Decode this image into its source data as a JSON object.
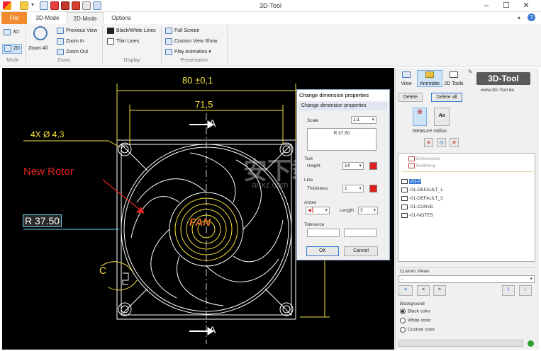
{
  "app": {
    "title": "3D-Tool"
  },
  "window_controls": {
    "minimize": "–",
    "maximize": "☐",
    "close": "✕"
  },
  "tabs": [
    "File",
    "3D-Mode",
    "2D-Mode",
    "Options"
  ],
  "ribbon": {
    "mode": {
      "b3d": "3D",
      "b2d": "2D",
      "group": "Mode"
    },
    "zoom": {
      "zoom_all": "Zoom All",
      "previous_view": "Previous View",
      "zoom_in": "Zoom In",
      "zoom_out": "Zoom Out",
      "group": "Zoom"
    },
    "display": {
      "black_white": "Black/White Lines",
      "thin": "Thin Lines",
      "group": "Display"
    },
    "presentation": {
      "full_screen": "Full Screen",
      "custom_view_show": "Custom View Show",
      "play_animation": "Play Animation",
      "group": "Presentation"
    }
  },
  "drawing": {
    "dim_80": "80 ±0,1",
    "dim_715": "71,5",
    "hole": "4X Ø 4,3",
    "label_a_top": "A",
    "label_a_bottom": "A",
    "label_c": "C",
    "new_rotor": "New Rotor",
    "radius": "R 37.50",
    "brand": "FAN"
  },
  "dialog": {
    "title": "Change dimension properties",
    "subtitle": "Change dimension properties",
    "scale_label": "Scale",
    "scale_value": "1:1",
    "text_value": "R 37.50",
    "text_label": "Text",
    "height_label": "Height",
    "height_value": "14",
    "line_label": "Line",
    "thickness_label": "Thickness",
    "thickness_value": "1",
    "arrow_label": "Arrow",
    "length_label": "Length",
    "length_value": "3",
    "tolerance_label": "Tolerance",
    "ok": "OK",
    "cancel": "Cancel"
  },
  "panel": {
    "view": "View",
    "annotate": "Annotate",
    "tools2d": "2D Tools",
    "logo": "3D-Tool",
    "url": "www.3D-Tool.de",
    "delete": "Delete",
    "delete_all": "Delete all",
    "measure_radius": "Measure radius",
    "tree": {
      "dimensions": "Dimensions",
      "redlining": "Redlining",
      "layers": [
        "-01-0",
        "-01-DEFAULT_1",
        "-01-DEFAULT_3",
        "-01-CURVE",
        "-01-NOTES"
      ]
    },
    "custom_views_label": "Custom Views",
    "custom_views_value": "...",
    "background_label": "Background",
    "bg_options": [
      "Black color",
      "White color",
      "Custom color"
    ],
    "bg_selected": 0
  },
  "watermark": {
    "line1": "安下载",
    "line2": "anxz.com"
  }
}
